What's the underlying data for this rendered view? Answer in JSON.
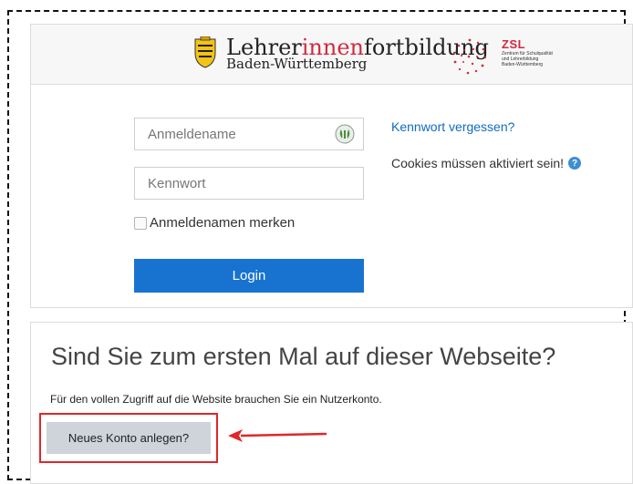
{
  "header": {
    "brand_line1_prefix": "Lehrer",
    "brand_line1_highlight": "innen",
    "brand_line1_suffix": "fortbildung",
    "brand_line2": "Baden-Württemberg",
    "zsl_title": "ZSL",
    "zsl_sub1": "Zentrum für Schulqualität",
    "zsl_sub2": "und Lehrerbildung",
    "zsl_sub3": "Baden-Württemberg"
  },
  "login": {
    "username_placeholder": "Anmeldename",
    "password_placeholder": "Kennwort",
    "remember_label": "Anmeldenamen merken",
    "remember_checked": false,
    "login_button": "Login",
    "forgot_link": "Kennwort vergessen?",
    "cookies_note": "Cookies müssen aktiviert sein!",
    "help_icon": "question-circle-icon"
  },
  "signup": {
    "heading": "Sind Sie zum ersten Mal auf dieser Webseite?",
    "info": "Für den vollen Zugriff auf die Website brauchen Sie ein Nutzerkonto.",
    "new_account_button": "Neues Konto anlegen?"
  },
  "colors": {
    "accent": "#1873d0",
    "link": "#0f6cbf",
    "brand_red": "#d22a3e",
    "annotation_red": "#e0272a"
  }
}
